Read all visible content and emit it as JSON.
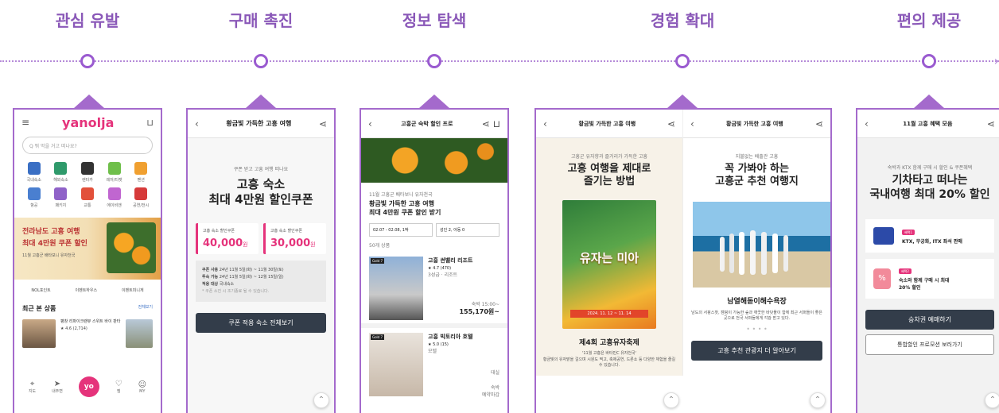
{
  "stages": [
    "관심 유발",
    "구매 촉진",
    "정보 탐색",
    "경험 확대",
    "편의 제공"
  ],
  "timeline_tip": "›",
  "screen1": {
    "logo": "yanolja",
    "search_placeholder": "Q 뭐 먹을 거고 떠나요?",
    "categories": [
      "국내숙소",
      "해외숙소",
      "렌터카",
      "레저/티켓",
      "항공",
      "펜션",
      "패키지",
      "교통",
      "에이비앤",
      "공연/전시"
    ],
    "banner_title": "전라남도 고흥 여행",
    "banner_sub": "최대 4만원 쿠폰 할인",
    "banner_note": "11월 고흥군 배타보니 유자천국",
    "shortcuts": [
      "NOL포인트",
      "이벤트하우스",
      "이벤트미니게"
    ],
    "recent_title": "최근 본 상품",
    "recent_more": "전체보기",
    "recent_name": "평창 리파이크랜뷰 스위트 바이 판타",
    "recent_rating": "★ 4.6 (2,714)",
    "nav": [
      "지도",
      "내주변",
      "yo",
      "찜",
      "MY"
    ]
  },
  "screen2": {
    "title": "황금빛 가득한 고흥 여행",
    "intro": "쿠폰 받고 고흥 여행 떠나요",
    "headline": [
      "고흥 숙소",
      "최대 4만원 할인쿠폰"
    ],
    "coupon1_label": "고흥 숙소 할인쿠폰",
    "coupon1_value": "40,000",
    "coupon1_unit": "원",
    "coupon2_label": "고흥 숙소 할인쿠폰",
    "coupon2_value": "30,000",
    "coupon2_unit": "원",
    "info": [
      [
        "쿠폰 사용",
        "24년 11월 5일(화) ~ 11월 30일(토)"
      ],
      [
        "투숙 가능",
        "24년 11월 5일(화) ~ 12월 15일(일)"
      ],
      [
        "적용 대상",
        "국내숙소"
      ]
    ],
    "info_note": "* 쿠폰 소진 시 조기종료 될 수 있습니다.",
    "cta": "쿠폰 적용 숙소 전체보기"
  },
  "screen3": {
    "title": "고흥군 숙박 할인 프로",
    "small": "11월 고흥군 배타보니 유자천국",
    "headline": [
      "황금빛 가득한 고흥 여행",
      "최대 4만원 쿠폰 할인 받기"
    ],
    "date": "02.07 - 02.08, 1박",
    "guests": "성인 2, 아동 0",
    "count": "50개 상품",
    "hotel1": {
      "badge": "Gold 7",
      "name": "고흥 썬밸리 리조트",
      "rating": "★ 4.7 (470)",
      "sub": "3성급 · 리조트",
      "price_label": "숙박 15:00~",
      "price": "155,170원~"
    },
    "hotel2": {
      "badge": "Gold 7",
      "name": "고흥 빅토리아 호텔",
      "rating": "★ 5.0 (15)",
      "sub": "모텔",
      "tag1": "대실",
      "tag2": "숙박",
      "status": "예약마감"
    }
  },
  "screen4": {
    "left_title": "황금빛 가득한 고흥 여행",
    "left_small": "고흥군 유자향과 즐거리가 가득한 고흥",
    "left_headline": [
      "고흥 여행을 제대로",
      "즐기는 방법"
    ],
    "poster_text": "유자는 미아",
    "poster_date": "2024. 11. 12 ~ 11. 14",
    "festival_title": "제4회 고흥유자축제",
    "festival_quote": "'11월 고흥은 바타민C 유자천국'",
    "festival_desc": "황금빛의 유자밭을 걸으며 시원도 찍고, 축제공연, 드론쇼 등 다양한 체험을 즐길 수 있습니다.",
    "right_title": "황금빛 가득한 고흥 여행",
    "right_small": "지불없는 배출관 고흥",
    "right_headline": [
      "꼭 가봐야 하는",
      "고흥군 추천 여행지"
    ],
    "spot_title": "남열해돋이해수욕장",
    "spot_desc": "남도의 서핑스팟, 캠핑이 가능한 숲과 깨끗한 바닷물이 함께 최근 서퍼들이 좋은 곳으로 전국 서퍼들에게 각광 받고 있다.",
    "spot_cta": "고흥 추천 관광지 더 알아보기"
  },
  "screen5": {
    "title": "11월 고흥 혜택 모음",
    "small": "숙박과 KTX 함께 구매 시 할인 & 쿠폰혜택",
    "headline": [
      "기차타고 떠나는",
      "국내여행 최대 20% 할인"
    ],
    "card1_badge": "혜택1",
    "card1_text": "KTX, 무궁화, ITX 좌석 판매",
    "card2_badge": "혜택2",
    "card2_text": "숙소와 함께 구매 시 최대 20% 할인",
    "cta1": "승차권 예매하기",
    "cta2": "통합할인 프로모션 보러가기"
  },
  "colors": {
    "accent": "#8a58b8",
    "timeline": "#b58ad8",
    "brand_pink": "#e5337b",
    "dark_button": "#333d4a"
  }
}
